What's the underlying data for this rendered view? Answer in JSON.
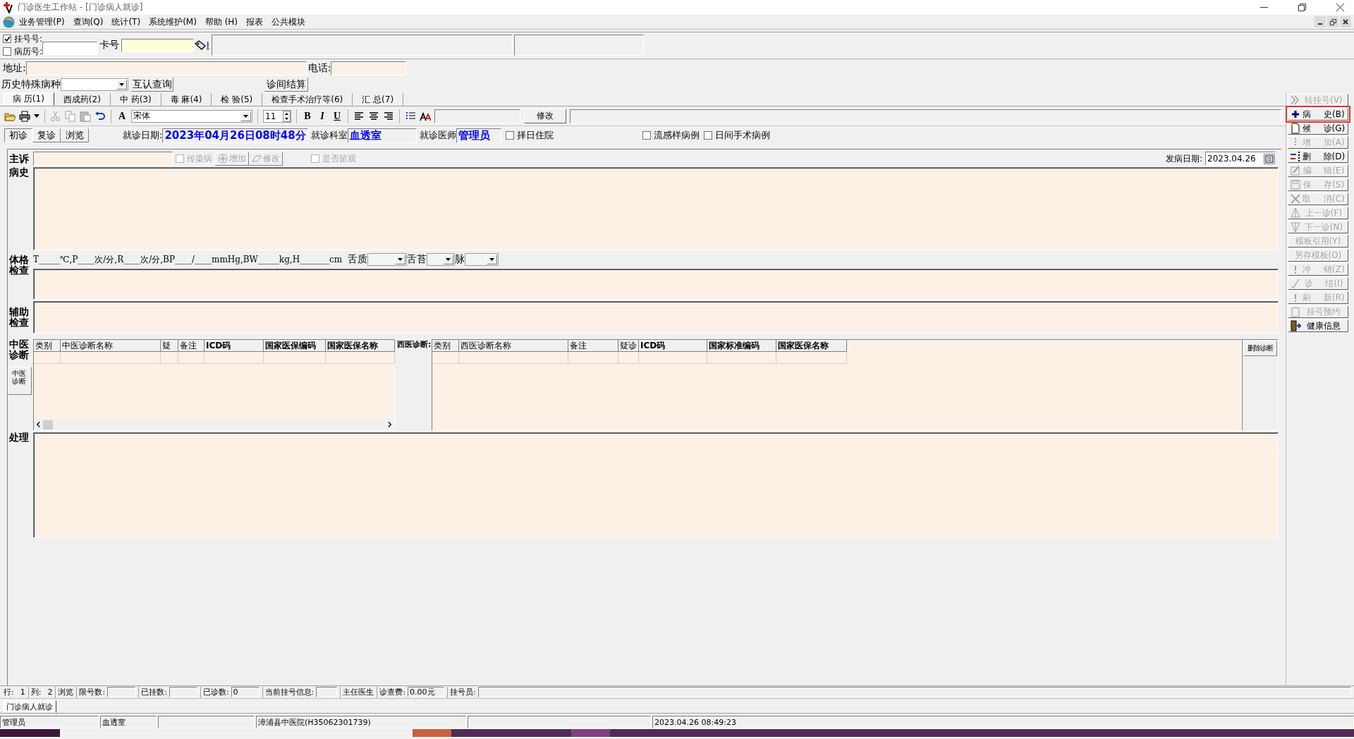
{
  "window": {
    "title": "门诊医生工作站 - [门诊病人就诊]"
  },
  "menu": [
    "业务管理(P)",
    "查询(Q)",
    "统计(T)",
    "系统维护(M)",
    "帮助 (H)",
    "报表",
    "公共模块"
  ],
  "registration": {
    "checks": [
      {
        "label": "挂号号:",
        "checked": true
      },
      {
        "label": "病历号:",
        "checked": false
      }
    ],
    "card_label": "卡号",
    "card_button": "I"
  },
  "address": {
    "label": "地址:",
    "phone_label": "电话:"
  },
  "history": {
    "label": "历史特殊病种",
    "mutual_button": "互认查询",
    "settle_button": "诊间结算"
  },
  "tabs": [
    {
      "label": "病 历(1)",
      "selected": true
    },
    {
      "label": "西成药(2)",
      "selected": false
    },
    {
      "label": "中 药(3)",
      "selected": false
    },
    {
      "label": "毒 麻(4)",
      "selected": false
    },
    {
      "label": "检 验(5)",
      "selected": false
    },
    {
      "label": "检查手术治疗等(6)",
      "selected": false
    },
    {
      "label": "汇 总(7)",
      "selected": false
    }
  ],
  "toolbar": {
    "font_icon": "A",
    "font": "宋体",
    "size": "11",
    "bold": "B",
    "italic": "I",
    "underline": "U",
    "modify_button": "修改"
  },
  "visit": {
    "modes": [
      {
        "label": "初诊",
        "selected": true
      },
      {
        "label": "复诊",
        "selected": false
      },
      {
        "label": "浏览",
        "selected": false
      }
    ],
    "date_label": "就诊日期:",
    "date": "2023年04月26日08时48分",
    "dept_label": "就诊科室",
    "dept": "血透室",
    "doctor_label": "就诊医师",
    "doctor": "管理员",
    "checks": [
      {
        "label": "择日住院",
        "checked": false
      },
      {
        "label": "流感样病例",
        "checked": false
      },
      {
        "label": "日间手术病例",
        "checked": false
      }
    ]
  },
  "record": {
    "complaint_label": "主诉",
    "infectious": {
      "label": "传染病",
      "checked": false,
      "disabled": true
    },
    "add_button": "增加",
    "edit_button": "修改",
    "observe": {
      "label": "是否留观",
      "checked": false,
      "disabled": true
    },
    "onset_label": "发病日期:",
    "onset_date": "2023.04.26",
    "history_label": "病史",
    "exam_label": "体格检查",
    "vitals": "T_____℃,P____次/分,R____次/分,BP____/____mmHg,BW_____kg,H_______cm",
    "tongue_label": "舌质",
    "coating_label": "舌苔",
    "pulse_label": "脉",
    "aux_label": "辅助检查",
    "treatment_label": "处理"
  },
  "tcm_diagnosis": {
    "label": "中医诊断",
    "tab": "中医诊断",
    "columns": [
      "类别",
      "中医诊断名称",
      "疑",
      "备注",
      "ICD码",
      "国家医保编码",
      "国家医保名称"
    ]
  },
  "western_diagnosis": {
    "label": "西医诊断:",
    "columns": [
      "类别",
      "西医诊断名称",
      "备注",
      "疑诊",
      "ICD码",
      "国家标准编码",
      "国家医保名称"
    ],
    "delete_button": "删除诊断"
  },
  "side_buttons": [
    {
      "label": "转挂号(V)",
      "kind": "chevrons",
      "disabled": true,
      "selected": false
    },
    {
      "label": "病 史(B)",
      "kind": "plus",
      "disabled": false,
      "selected": true
    },
    {
      "label": "候 诊(G)",
      "kind": "page",
      "disabled": false,
      "selected": false
    },
    {
      "label": "增 加(A)",
      "kind": "dots",
      "disabled": true,
      "selected": false
    },
    {
      "label": "删 除(D)",
      "kind": "delete",
      "disabled": false,
      "selected": false
    },
    {
      "label": "编 辑(E)",
      "kind": "edit",
      "disabled": true,
      "selected": false
    },
    {
      "label": "保 存(S)",
      "kind": "save",
      "disabled": true,
      "selected": false
    },
    {
      "label": "取 消(C)",
      "kind": "cross",
      "disabled": true,
      "selected": false
    },
    {
      "label": "上一诊(F)",
      "kind": "up",
      "disabled": true,
      "selected": false
    },
    {
      "label": "下一诊(N)",
      "kind": "down",
      "disabled": true,
      "selected": false
    },
    {
      "label": "模板引用(Y)",
      "kind": "none",
      "disabled": true,
      "selected": false
    },
    {
      "label": "另存模板(O)",
      "kind": "none",
      "disabled": true,
      "selected": false
    },
    {
      "label": "冲 销(Z)",
      "kind": "bang",
      "disabled": true,
      "selected": false
    },
    {
      "label": "诊 结(I)",
      "kind": "tick",
      "disabled": true,
      "selected": false
    },
    {
      "label": "刷 新(R)",
      "kind": "bang",
      "disabled": true,
      "selected": false
    },
    {
      "label": "挂号预约",
      "kind": "clipboard",
      "disabled": true,
      "selected": false
    },
    {
      "label": "健康信息",
      "kind": "door",
      "disabled": false,
      "selected": false
    }
  ],
  "status_bar": [
    {
      "kind": "pair",
      "label": "行:",
      "value": "1"
    },
    {
      "kind": "pair",
      "label": "列:",
      "value": "2"
    },
    {
      "kind": "text",
      "label": "浏览"
    },
    {
      "kind": "field",
      "label": "限号数:"
    },
    {
      "kind": "field",
      "label": "已挂数:"
    },
    {
      "kind": "field",
      "label": "已诊数:",
      "value": "0"
    },
    {
      "kind": "field",
      "label": "当前挂号信息:"
    },
    {
      "kind": "text",
      "label": "主任医生"
    },
    {
      "kind": "field",
      "label": "诊查费:",
      "value": "0.00元"
    },
    {
      "kind": "field",
      "label": "挂号员:"
    }
  ],
  "task_tabs": [
    {
      "label": "门诊病人就诊",
      "selected": true
    }
  ],
  "footer": [
    {
      "kind": "cell",
      "text": "管理员"
    },
    {
      "kind": "cell",
      "text": "血透室"
    },
    {
      "kind": "blank"
    },
    {
      "kind": "cell",
      "text": "漳浦县中医院(H35062301739)"
    },
    {
      "kind": "blank"
    },
    {
      "kind": "cell",
      "text": "2023.04.26 08:49:23"
    }
  ]
}
